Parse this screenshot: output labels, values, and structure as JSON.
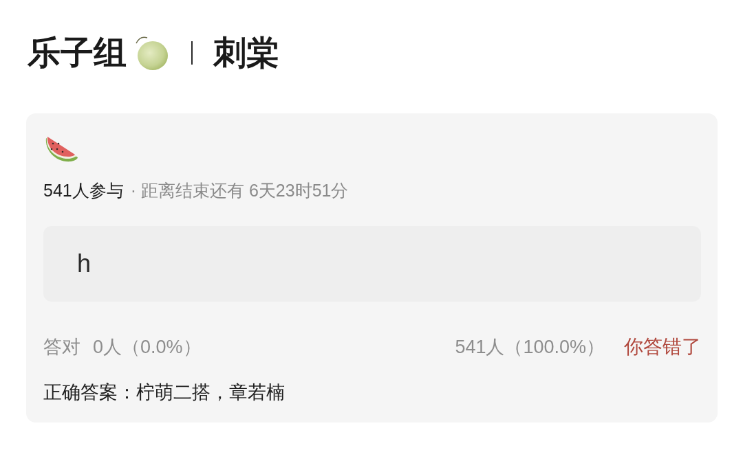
{
  "header": {
    "group": "乐子组",
    "topic": "刺棠"
  },
  "quiz": {
    "participants": "541人参与",
    "countdown": "· 距离结束还有 6天23时51分",
    "answer": "h",
    "correct_label": "答对",
    "correct_count": "0人（0.0%）",
    "wrong_count": "541人（100.0%）",
    "answered_correctly": false,
    "verdict": "你答错了",
    "solution": "正确答案：柠萌二搭，章若楠"
  }
}
